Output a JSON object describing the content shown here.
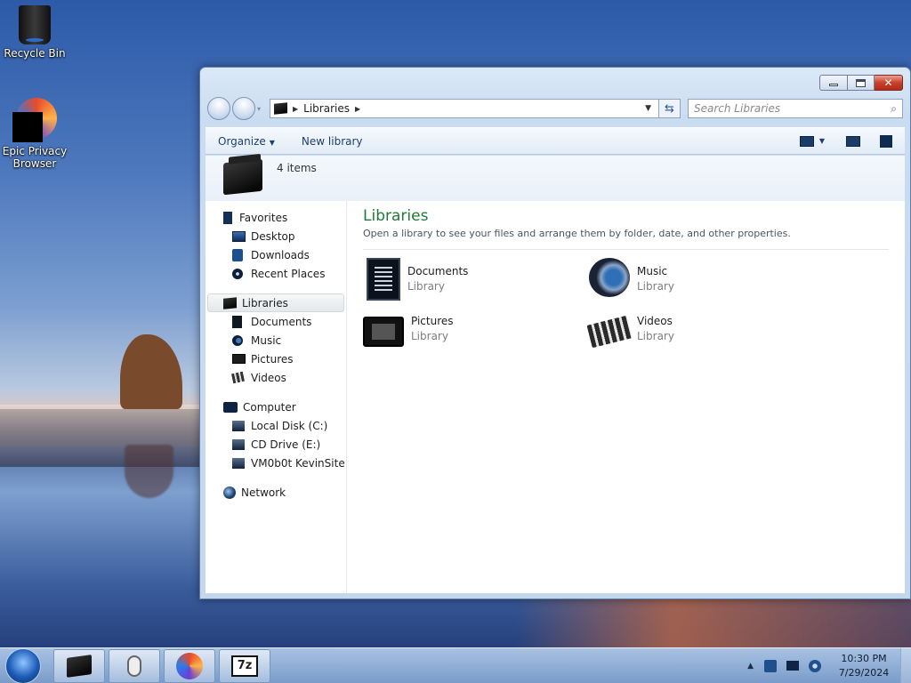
{
  "desktop": {
    "icons": [
      {
        "label": "Recycle Bin",
        "icon": "recycle-bin-icon"
      },
      {
        "label": "Epic Privacy Browser",
        "icon": "epic-browser-icon"
      }
    ]
  },
  "window": {
    "address": {
      "path": [
        "Libraries"
      ]
    },
    "search": {
      "placeholder": "Search Libraries"
    },
    "toolbar": {
      "organize": "Organize",
      "new_library": "New library"
    },
    "details": {
      "count": "4 items"
    },
    "nav": {
      "favorites": {
        "label": "Favorites",
        "items": [
          "Desktop",
          "Downloads",
          "Recent Places"
        ]
      },
      "libraries": {
        "label": "Libraries",
        "items": [
          "Documents",
          "Music",
          "Pictures",
          "Videos"
        ]
      },
      "computer": {
        "label": "Computer",
        "items": [
          "Local Disk (C:)",
          "CD Drive (E:)",
          "VM0b0t KevinSite"
        ]
      },
      "network": {
        "label": "Network"
      }
    },
    "content": {
      "title": "Libraries",
      "subtitle": "Open a library to see your files and arrange them by folder, date, and other properties.",
      "libraries": [
        {
          "name": "Documents",
          "type": "Library",
          "icon": "documents-library-icon"
        },
        {
          "name": "Music",
          "type": "Library",
          "icon": "music-library-icon"
        },
        {
          "name": "Pictures",
          "type": "Library",
          "icon": "pictures-library-icon"
        },
        {
          "name": "Videos",
          "type": "Library",
          "icon": "videos-library-icon"
        }
      ]
    }
  },
  "taskbar": {
    "pinned": [
      "explorer-libraries-icon",
      "mouse-icon",
      "epic-browser-icon",
      "7zip-icon"
    ],
    "tray_glyph_7z": "7z",
    "clock": {
      "time": "10:30 PM",
      "date": "7/29/2024"
    }
  }
}
